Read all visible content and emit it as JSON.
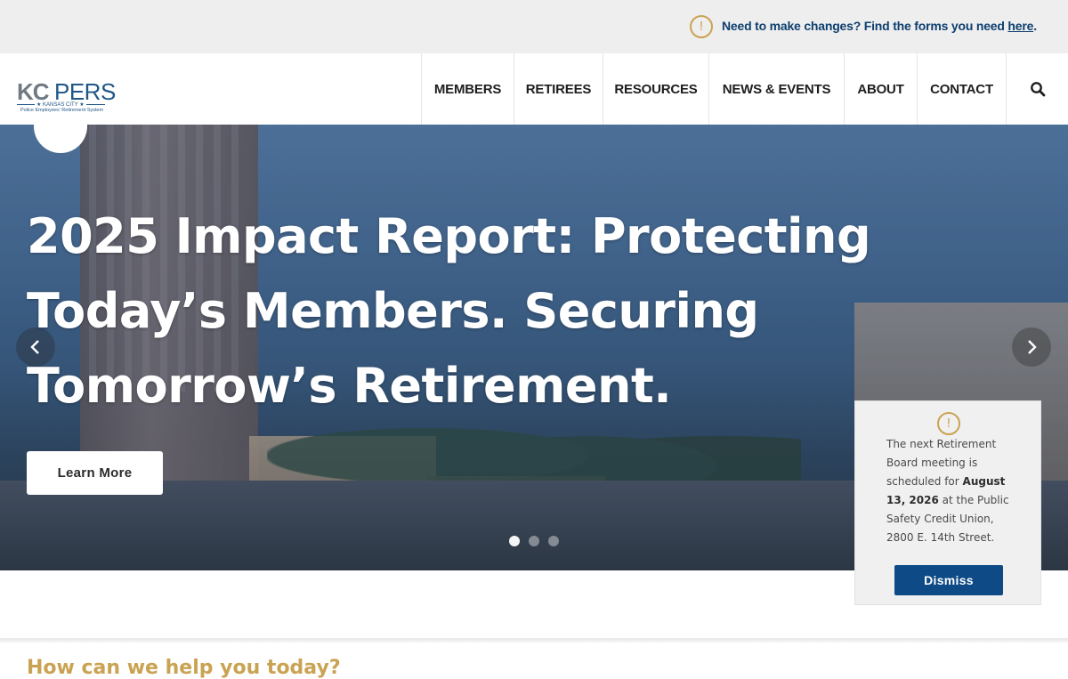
{
  "topbar": {
    "icon": "alert-circle-icon",
    "notice_text": "Need to make changes? Find the forms you need ",
    "notice_link": "here",
    "notice_end": "."
  },
  "logo": {
    "kc": "KC",
    "pers": "PERS",
    "city": "★ KANSAS CITY ★",
    "subtitle": "Police Employees' Retirement System"
  },
  "nav": {
    "items": [
      {
        "label": "MEMBERS"
      },
      {
        "label": "RETIREES"
      },
      {
        "label": "RESOURCES"
      },
      {
        "label": "NEWS & EVENTS"
      },
      {
        "label": "ABOUT"
      },
      {
        "label": "CONTACT"
      }
    ],
    "search_icon": "search-icon"
  },
  "hero": {
    "title": "2025 Impact Report: Protecting Today’s Members. Securing Tomorrow’s Retirement.",
    "cta_label": "Learn More",
    "prev_icon": "chevron-left-icon",
    "next_icon": "chevron-right-icon",
    "slide_count": 3,
    "active_slide": 1
  },
  "popup": {
    "icon": "alert-circle-icon",
    "text_before": "The next Retirement Board meeting is scheduled for ",
    "date": "August 13, 2026",
    "text_after": " at the Public Safety Credit Union, 2800 E. 14th Street.",
    "dismiss_label": "Dismiss"
  },
  "help": {
    "heading": "How can we help you today?"
  },
  "colors": {
    "accent_gold": "#c9a352",
    "brand_blue": "#0e3f6e",
    "button_blue": "#0d4a86"
  }
}
